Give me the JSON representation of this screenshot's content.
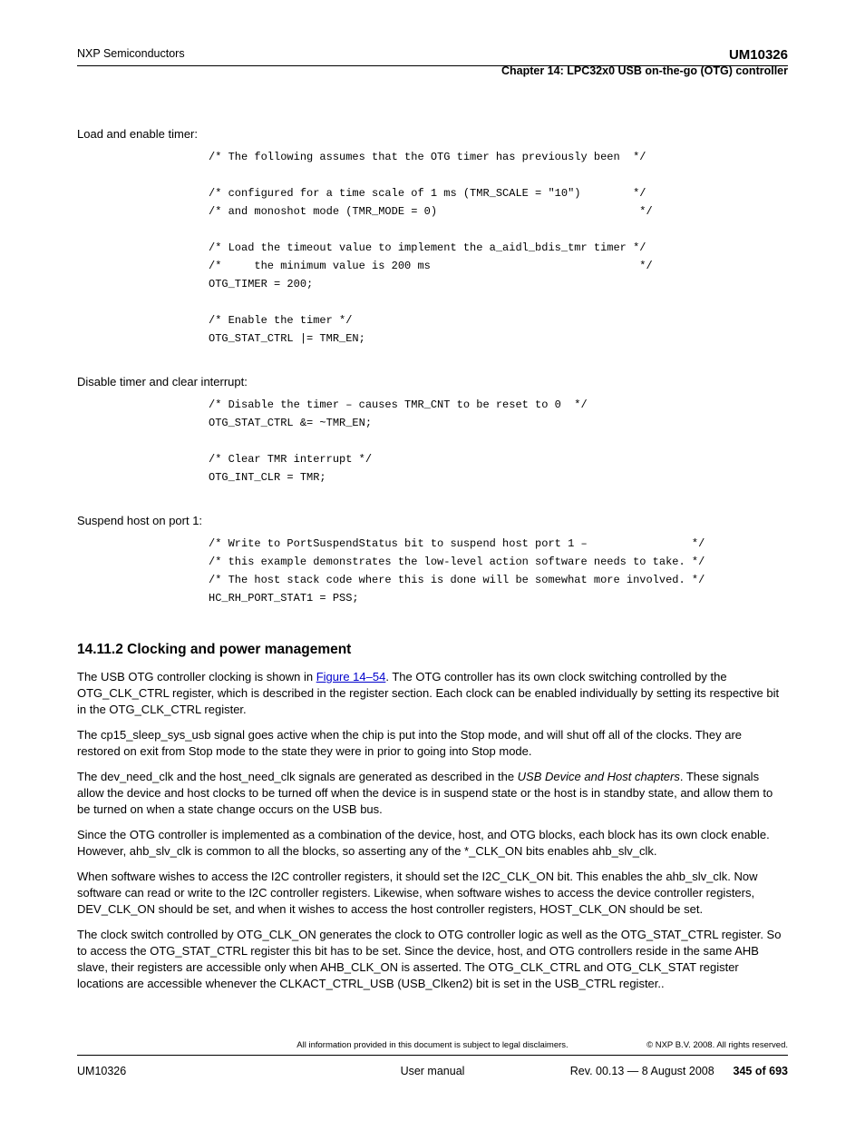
{
  "header": {
    "left": "NXP Semiconductors",
    "right_line1": "UM10326",
    "right_line2": "Chapter 14: LPC32x0 USB on-the-go (OTG) controller"
  },
  "sections": {
    "s1": {
      "label": "Load and enable timer:",
      "code": "/* The following assumes that the OTG timer has previously been  */\n\n/* configured for a time scale of 1 ms (TMR_SCALE = \"10\")        */\n/* and monoshot mode (TMR_MODE = 0)                               */\n\n/* Load the timeout value to implement the a_aidl_bdis_tmr timer */\n/*     the minimum value is 200 ms                                */\nOTG_TIMER = 200;\n\n/* Enable the timer */\nOTG_STAT_CTRL |= TMR_EN;"
    },
    "s2": {
      "label": "Disable timer and clear interrupt:",
      "code": "/* Disable the timer – causes TMR_CNT to be reset to 0  */\nOTG_STAT_CTRL &= ~TMR_EN;\n\n/* Clear TMR interrupt */\nOTG_INT_CLR = TMR;"
    },
    "s3": {
      "label": "Suspend host on port 1:",
      "code": "/* Write to PortSuspendStatus bit to suspend host port 1 –                */\n/* this example demonstrates the low-level action software needs to take. */\n/* The host stack code where this is done will be somewhat more involved. */\nHC_RH_PORT_STAT1 = PSS;"
    }
  },
  "heading": "14.11.2 Clocking and power management",
  "paragraphs": {
    "p1_pre": "The USB OTG controller clocking is shown in ",
    "p1_link": "Figure 14–54",
    "p1_post": ". The OTG controller has its own clock switching controlled by the OTG_CLK_CTRL register, which is described in the register section. Each clock can be enabled individually by setting its respective bit in the OTG_CLK_CTRL register.",
    "p2": "The cp15_sleep_sys_usb signal goes active when the chip is put into the Stop mode, and will shut off all of the clocks. They are restored on exit from Stop mode to the state they were in prior to going into Stop mode.",
    "p3_pre": "The dev_need_clk and the host_need_clk signals are generated as described in the ",
    "p3_ital": "USB Device and Host chapters",
    "p3_post": ". These signals allow the device and host clocks to be turned off when the device is in suspend state or the host is in standby state, and allow them to be turned on when a state change occurs on the USB bus.",
    "p4": "Since the OTG controller is implemented as a combination of the device, host, and OTG blocks, each block has its own clock enable. However, ahb_slv_clk is common to all the blocks, so asserting any of the *_CLK_ON bits enables ahb_slv_clk.",
    "p5": "When software wishes to access the I2C controller registers, it should set the I2C_CLK_ON bit. This enables the ahb_slv_clk. Now software can read or write to the I2C controller registers. Likewise, when software wishes to access the device controller registers, DEV_CLK_ON should be set, and when it wishes to access the host controller registers, HOST_CLK_ON should be set.",
    "p6": "The clock switch controlled by OTG_CLK_ON generates the clock to OTG controller logic as well as the OTG_STAT_CTRL register. So to access the OTG_STAT_CTRL register this bit has to be set. Since the device, host, and OTG controllers reside in the same AHB slave, their registers are accessible only when AHB_CLK_ON is asserted. The OTG_CLK_CTRL and OTG_CLK_STAT register locations are accessible whenever the CLKACT_CTRL_USB (USB_Clken2) bit is set in the USB_CTRL register.."
  },
  "footer": {
    "left": "UM10326",
    "center": "User manual",
    "right": "Rev. 00.13 — 8 August 2008",
    "pagenum": "345 of 693",
    "copyright": "© NXP B.V. 2008. All rights reserved.",
    "disclaimer": "All information provided in this document is subject to legal disclaimers."
  }
}
